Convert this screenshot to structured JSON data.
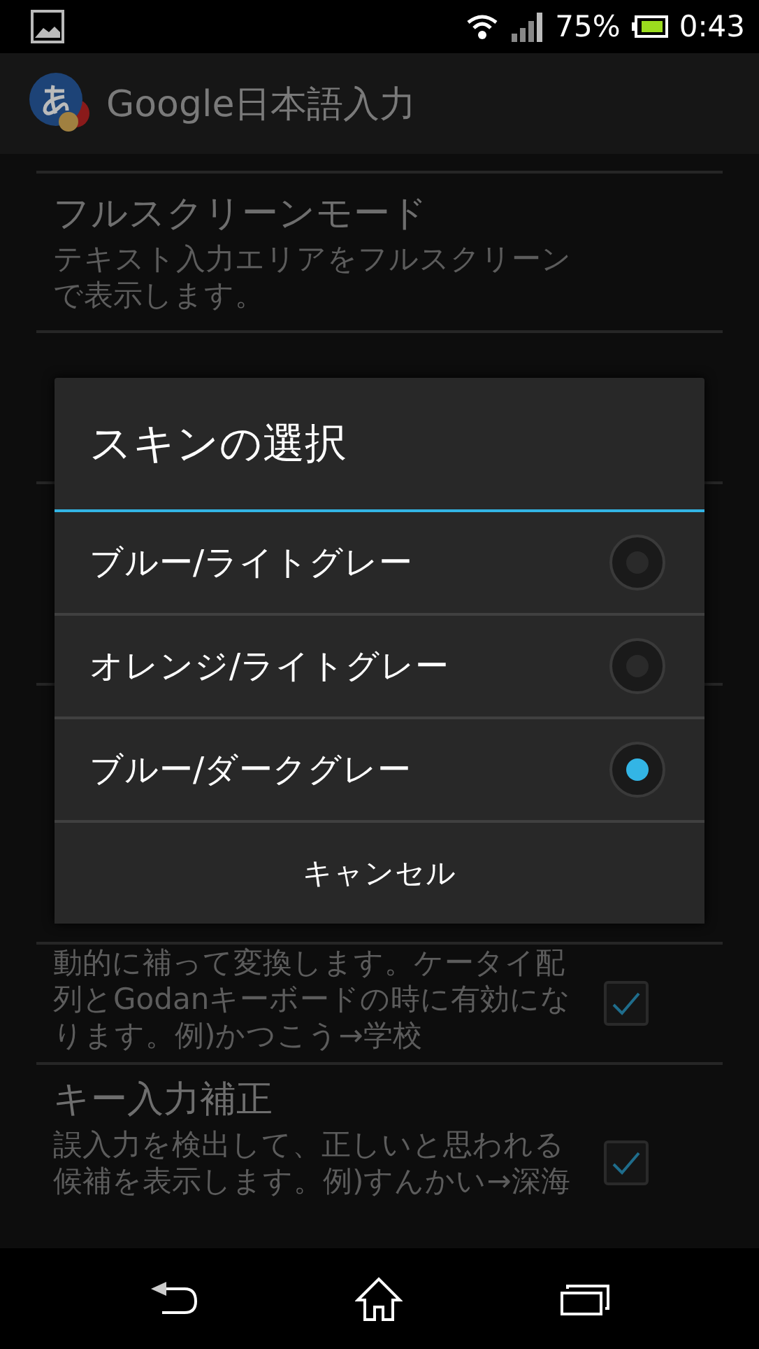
{
  "status_bar": {
    "battery_percent": "75%",
    "time": "0:43"
  },
  "app_bar": {
    "title": "Google日本語入力"
  },
  "settings": [
    {
      "kind": "item",
      "title": "フルスクリーンモード",
      "summary": "テキスト入力エリアをフルスクリーンで表示します。"
    },
    {
      "kind": "covered"
    },
    {
      "kind": "checkbox",
      "summary": "動的に補って変換します。ケータイ配列とGodanキーボードの時に有効になります。例)かつこう→学校",
      "checked": true
    },
    {
      "kind": "checkbox",
      "title": "キー入力補正",
      "summary": "誤入力を検出して、正しいと思われる候補を表示します。例)すんかい→深海",
      "checked": true
    }
  ],
  "dialog": {
    "title": "スキンの選択",
    "options": [
      {
        "label": "ブルー/ライトグレー",
        "selected": false
      },
      {
        "label": "オレンジ/ライトグレー",
        "selected": false
      },
      {
        "label": "ブルー/ダークグレー",
        "selected": true
      }
    ],
    "cancel": "キャンセル"
  }
}
